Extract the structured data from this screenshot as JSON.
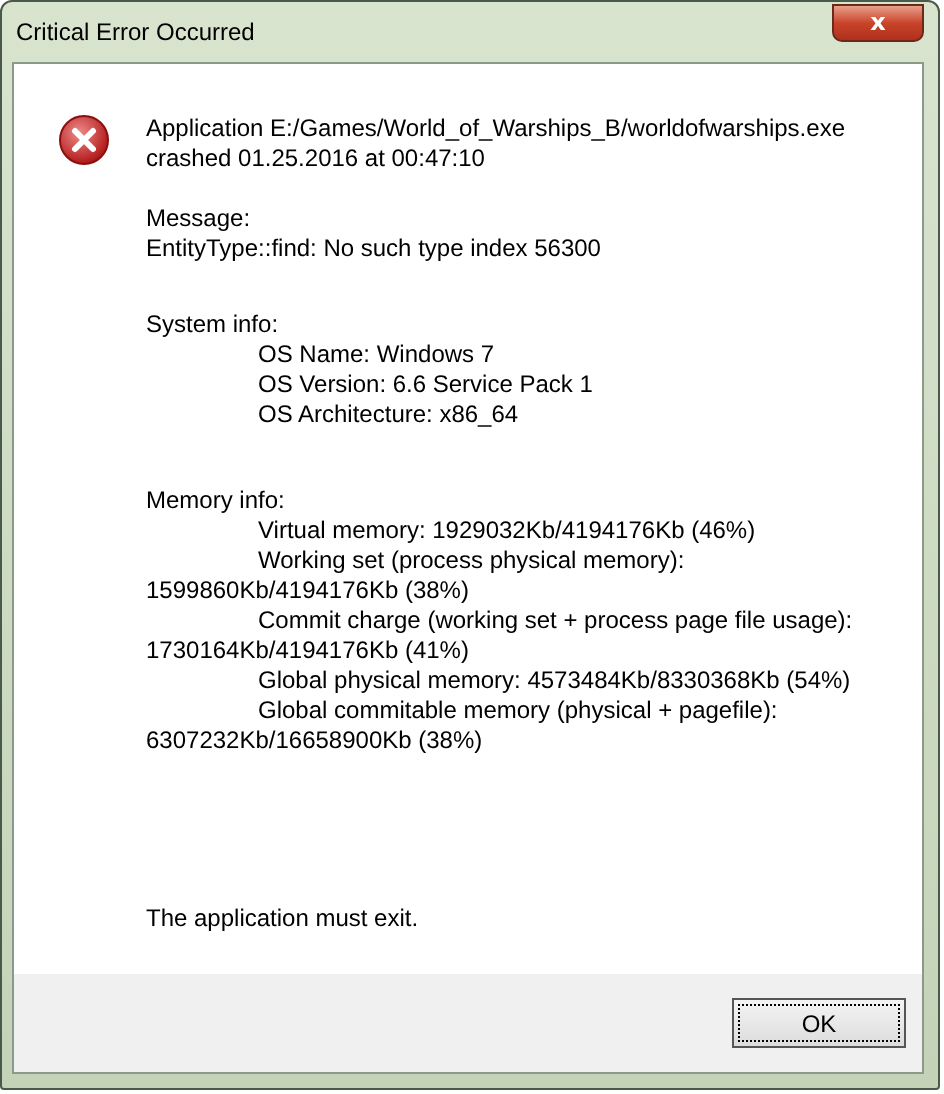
{
  "window": {
    "title": "Critical Error Occurred",
    "close_label": "x"
  },
  "sections": [
    {
      "lines": [
        {
          "text": "Application E:/Games/World_of_Warships_B/worldofwarships.exe",
          "kind": "plain"
        },
        {
          "text": "crashed 01.25.2016 at 00:47:10",
          "kind": "plain"
        }
      ]
    },
    {
      "lines": [
        {
          "text": "Message:",
          "kind": "plain"
        },
        {
          "text": "EntityType::find: No such type index 56300",
          "kind": "plain"
        }
      ]
    },
    {
      "lines": [
        {
          "text": "System info:",
          "kind": "plain"
        },
        {
          "text": "OS Name: Windows 7",
          "kind": "indented"
        },
        {
          "text": "OS Version: 6.6 Service Pack 1",
          "kind": "indented"
        },
        {
          "text": "OS Architecture: x86_64",
          "kind": "indented"
        }
      ]
    },
    {
      "lines": [
        {
          "text": "Memory info:",
          "kind": "plain"
        },
        {
          "text": "Virtual memory: 1929032Kb/4194176Kb (46%)",
          "kind": "indented"
        },
        {
          "text": "Working set (process physical memory):",
          "kind": "indented"
        },
        {
          "text": "1599860Kb/4194176Kb (38%)",
          "kind": "plain"
        },
        {
          "text": "Commit charge (working set + process page file usage):",
          "kind": "indented"
        },
        {
          "text": "1730164Kb/4194176Kb (41%)",
          "kind": "plain"
        },
        {
          "text": "Global physical memory: 4573484Kb/8330368Kb (54%)",
          "kind": "indented"
        },
        {
          "text": "Global commitable memory (physical + pagefile):",
          "kind": "indented"
        },
        {
          "text": "6307232Kb/16658900Kb (38%)",
          "kind": "plain"
        }
      ]
    },
    {
      "lines": [
        {
          "text": "The application must exit.",
          "kind": "plain"
        }
      ]
    }
  ],
  "buttons": [
    "OK"
  ]
}
